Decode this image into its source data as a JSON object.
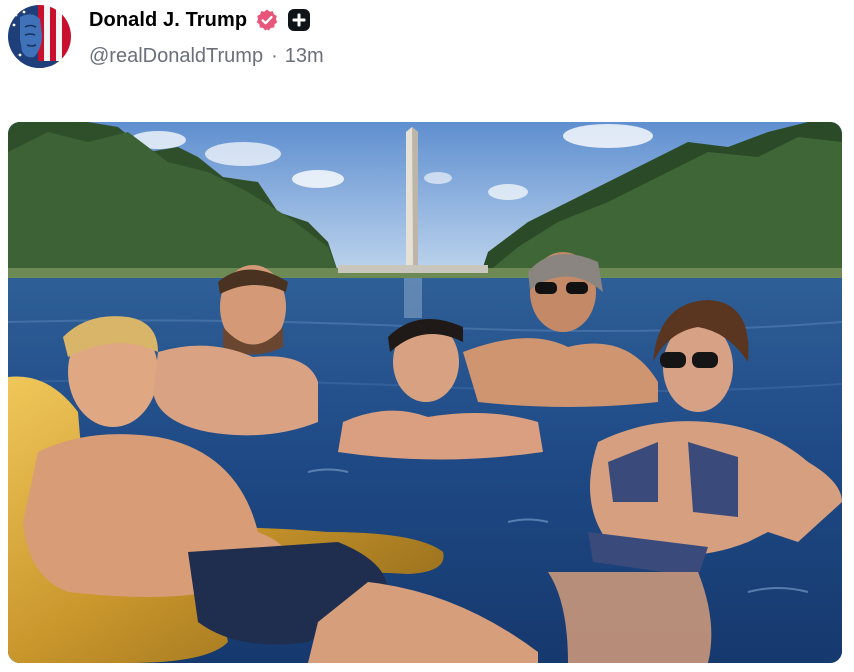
{
  "post": {
    "author": {
      "display_name": "Donald J. Trump",
      "handle": "@realDonaldTrump",
      "verified": true,
      "avatar_icon": "flag-portrait-avatar",
      "badge_icon": "verified-badge-icon",
      "platform_icon": "plus-icon"
    },
    "separator": "·",
    "timestamp": "13m",
    "media": {
      "kind": "photo",
      "subject": "Five people swimming in the Lincoln Memorial Reflecting Pool with the Washington Monument behind them"
    }
  },
  "colors": {
    "name_text": "#000000",
    "meta_text": "#6b6f7a",
    "verified_badge": "#e8557a",
    "platform_badge": "#0f1419"
  }
}
